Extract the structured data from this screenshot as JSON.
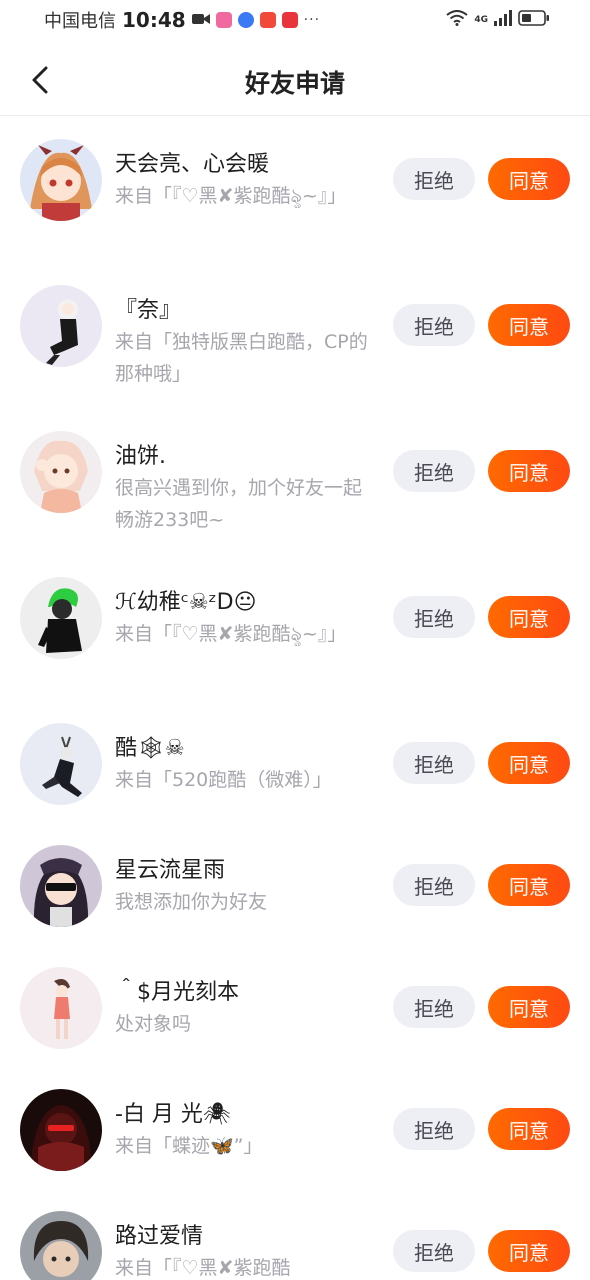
{
  "status_bar": {
    "carrier": "中国电信",
    "time": "10:48",
    "dots": "···",
    "network": "4G",
    "app_icons": [
      "video-icon",
      "app-pink-icon",
      "music-icon",
      "shop-red-icon",
      "book-red-icon"
    ]
  },
  "header": {
    "title": "好友申请",
    "back_icon": "chevron-left-icon"
  },
  "colors": {
    "accept": "#ff5a0a",
    "reject_bg": "#eeeef5",
    "message": "#a6a6ad"
  },
  "requests": [
    {
      "name": "天会亮、心会暖",
      "message": "来自「『♡黑✘紫跑酷ৡ~』」",
      "reject": "拒绝",
      "accept": "同意"
    },
    {
      "name": "『奈』",
      "message": "来自「独特版黑白跑酷，CP的那种哦」",
      "reject": "拒绝",
      "accept": "同意"
    },
    {
      "name": "油饼.",
      "message": "很高兴遇到你，加个好友一起畅游233吧~",
      "reject": "拒绝",
      "accept": "同意"
    },
    {
      "name": "ℋ幼稚ᶜ☠ᶻD😐",
      "message": "来自「『♡黑✘紫跑酷ৡ~』」",
      "reject": "拒绝",
      "accept": "同意"
    },
    {
      "name": "酷🕸☠",
      "message": "来自「520跑酷（微难）」",
      "reject": "拒绝",
      "accept": "同意"
    },
    {
      "name": "星云流星雨",
      "message": "我想添加你为好友",
      "reject": "拒绝",
      "accept": "同意"
    },
    {
      "name": "＾$月光刻本",
      "message": "处对象吗",
      "reject": "拒绝",
      "accept": "同意"
    },
    {
      "name": "-白 月 光🕷",
      "message": "来自「蝶迹🦋”」",
      "reject": "拒绝",
      "accept": "同意"
    },
    {
      "name": "路过爱情",
      "message": "来自「『♡黑✘紫跑酷",
      "reject": "拒绝",
      "accept": "同意"
    }
  ]
}
